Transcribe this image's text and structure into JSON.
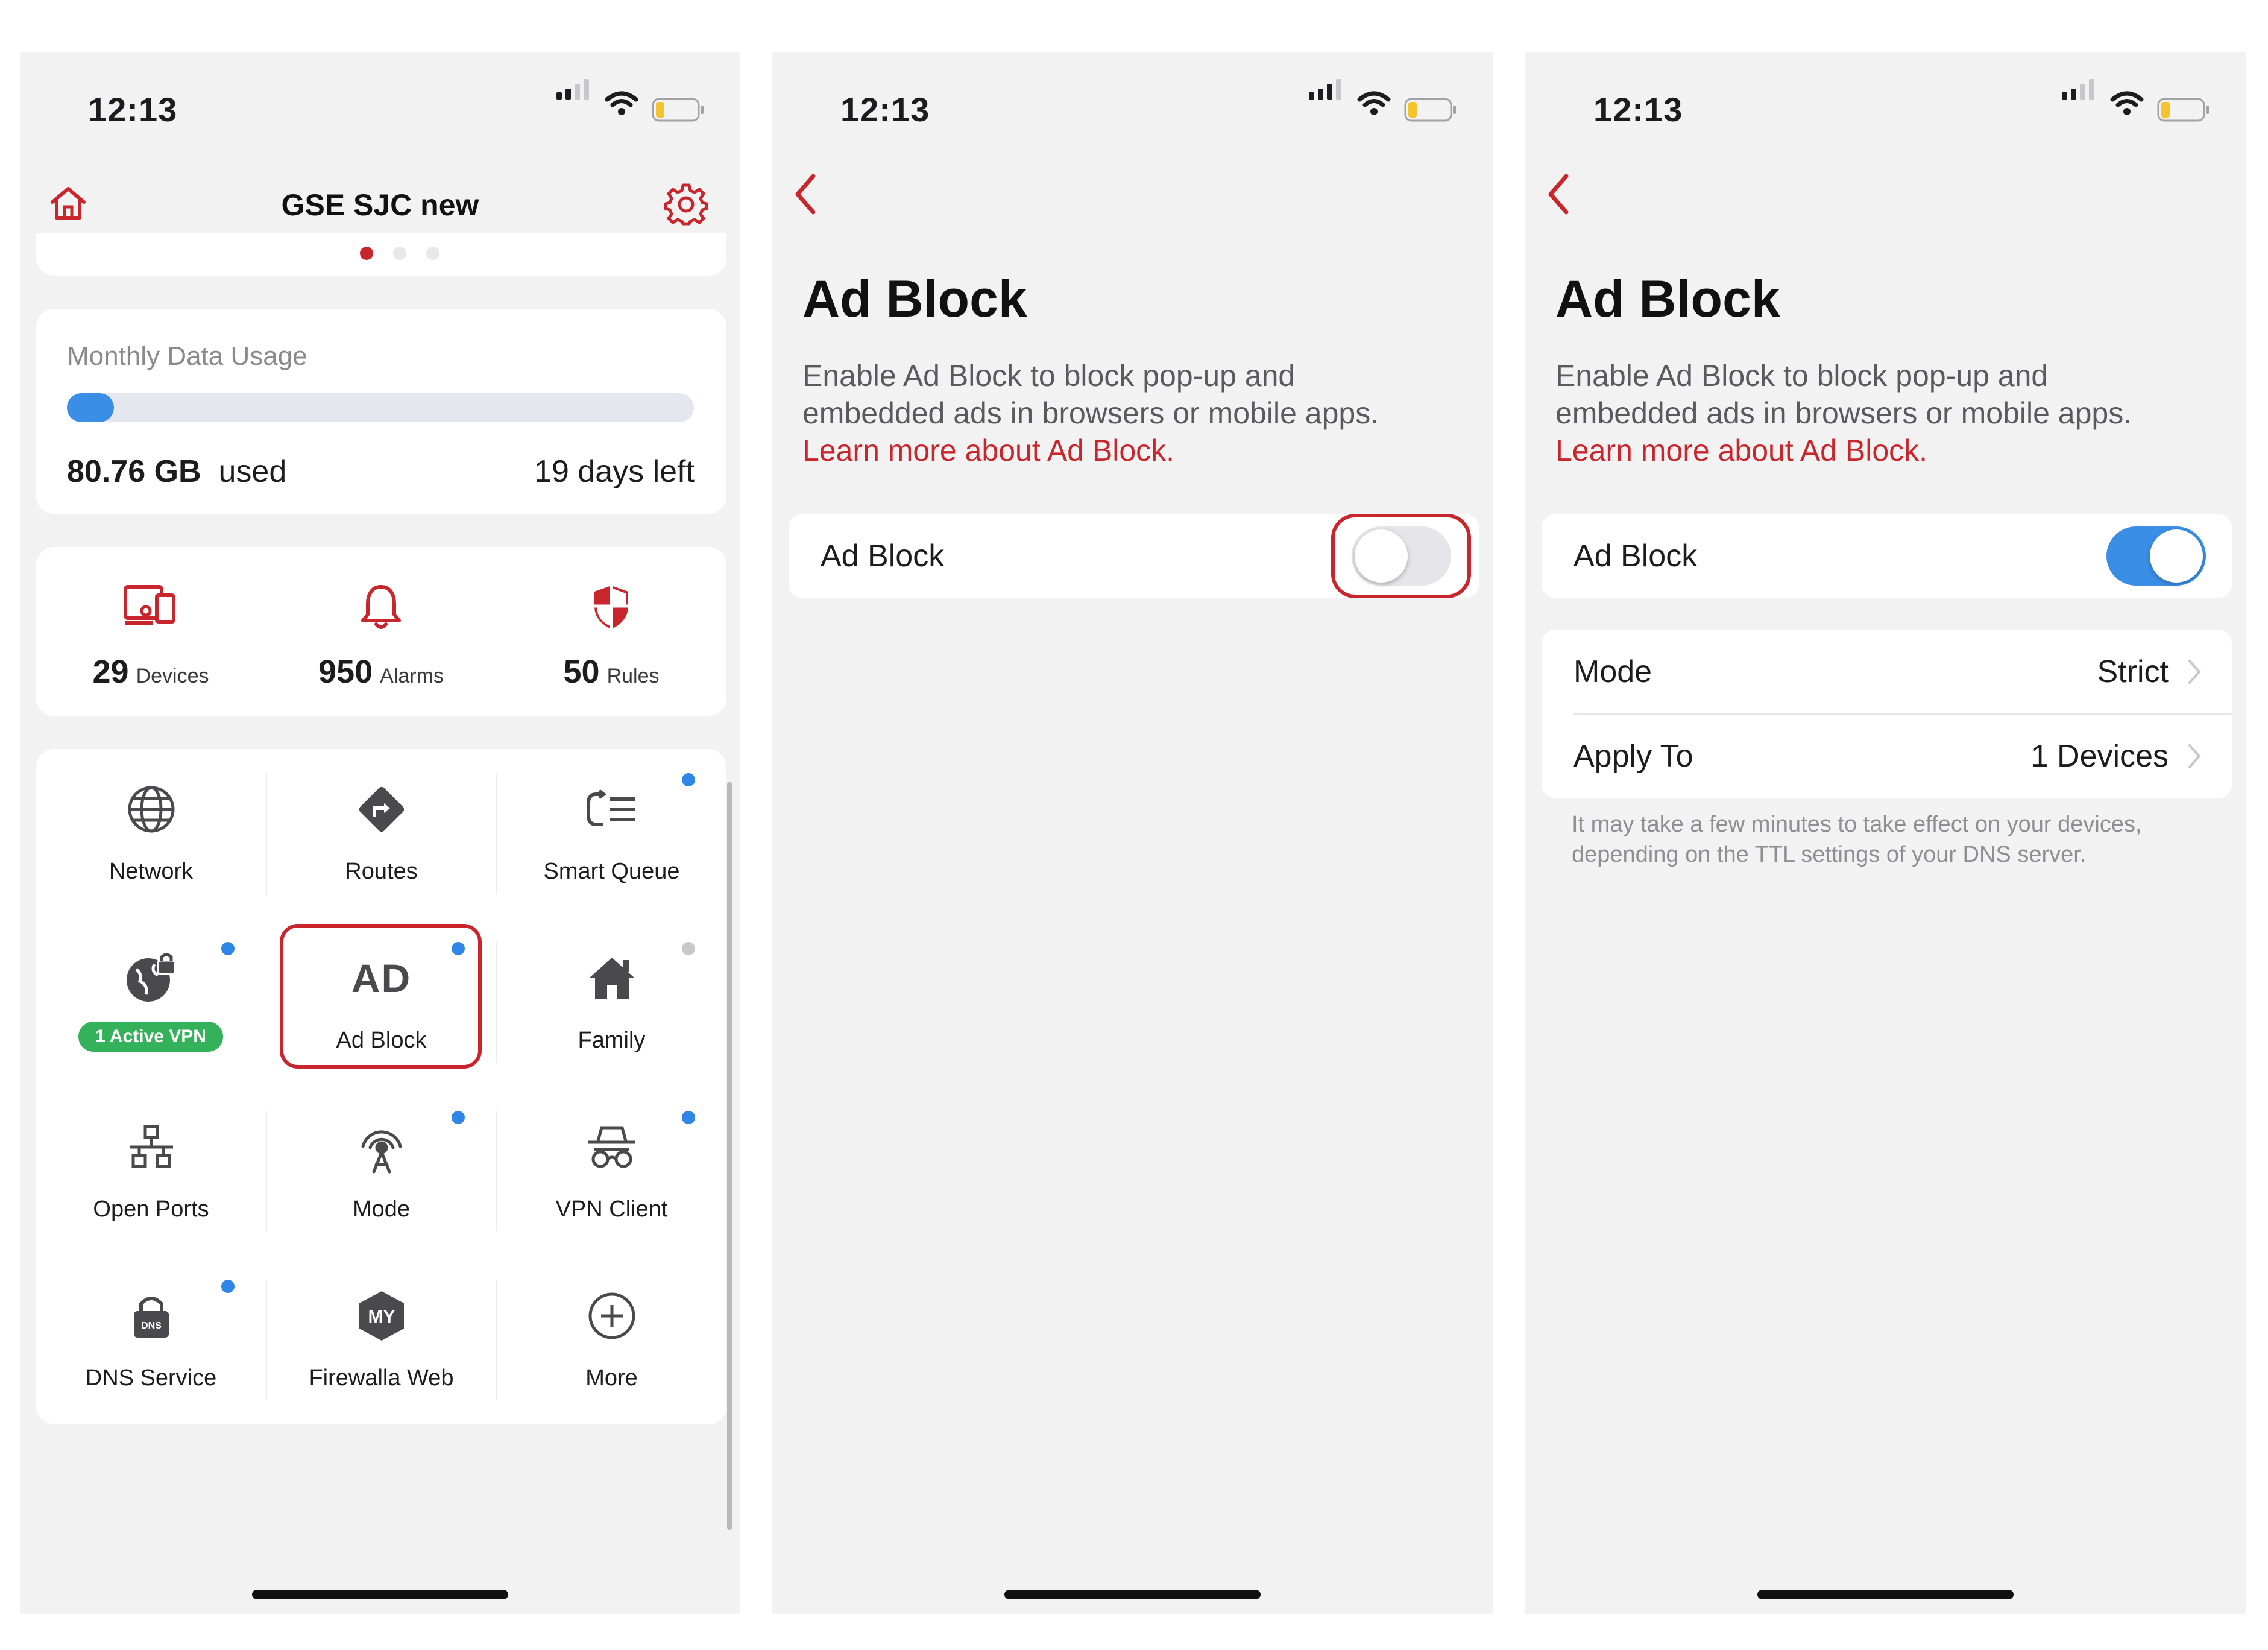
{
  "status_bar": {
    "time": "12:13"
  },
  "screen1": {
    "title": "GSE SJC new",
    "usage": {
      "label": "Monthly Data Usage",
      "used_value": "80.76 GB",
      "used_label": "used",
      "days_left": "19 days left",
      "progress_fraction": 0.075
    },
    "stats": [
      {
        "icon": "devices-icon",
        "value": "29",
        "label": "Devices"
      },
      {
        "icon": "bell-icon",
        "value": "950",
        "label": "Alarms"
      },
      {
        "icon": "shield-icon",
        "value": "50",
        "label": "Rules"
      }
    ],
    "features": [
      {
        "label": "Network",
        "icon": "globe-icon"
      },
      {
        "label": "Routes",
        "icon": "route-sign-icon"
      },
      {
        "label": "Smart Queue",
        "icon": "queue-icon"
      },
      {
        "label": "1 Active VPN",
        "icon": "vpn-globe-lock-icon"
      },
      {
        "label": "Ad Block",
        "icon": "ad-icon",
        "icon_text": "AD"
      },
      {
        "label": "Family",
        "icon": "house-icon"
      },
      {
        "label": "Open Ports",
        "icon": "network-ports-icon"
      },
      {
        "label": "Mode",
        "icon": "antenna-icon"
      },
      {
        "label": "VPN Client",
        "icon": "incognito-icon"
      },
      {
        "label": "DNS Service",
        "icon": "dns-lock-icon",
        "icon_text": "DNS"
      },
      {
        "label": "Firewalla Web",
        "icon": "my-hexagon-icon",
        "icon_text": "MY"
      },
      {
        "label": "More",
        "icon": "plus-circle-icon"
      }
    ]
  },
  "screen2": {
    "title": "Ad Block",
    "description": "Enable Ad Block to block pop-up and embedded ads in browsers or mobile apps.",
    "link": "Learn more about Ad Block.",
    "toggle_label": "Ad Block",
    "toggle_on": false
  },
  "screen3": {
    "title": "Ad Block",
    "description": "Enable Ad Block to block pop-up and embedded ads in browsers or mobile apps.",
    "link": "Learn more about Ad Block.",
    "toggle_label": "Ad Block",
    "toggle_on": true,
    "mode_label": "Mode",
    "mode_value": "Strict",
    "apply_label": "Apply To",
    "apply_value": "1 Devices",
    "note": "It may take a few minutes to take effect on your devices, depending on the TTL settings of your DNS server."
  },
  "colors": {
    "accent_red": "#c8262c",
    "toggle_blue": "#3b8ee6",
    "badge_green": "#34b25b",
    "dot_blue": "#2f86e6"
  }
}
